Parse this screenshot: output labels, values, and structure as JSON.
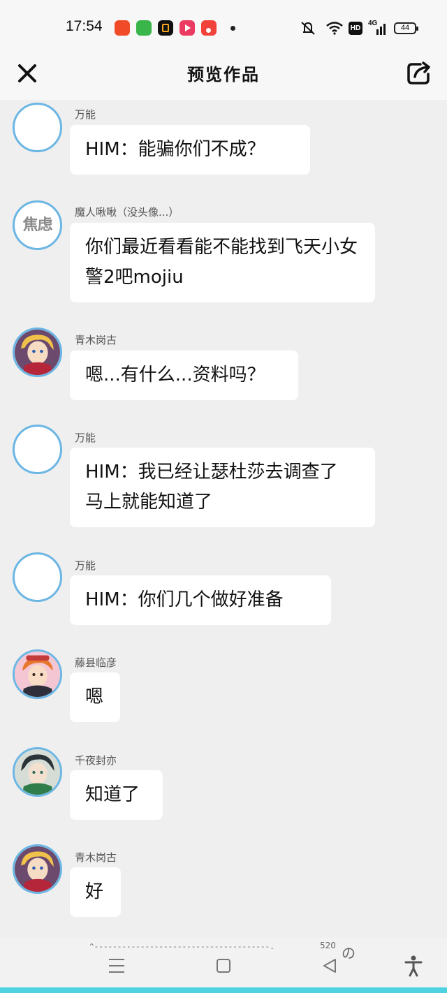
{
  "status_bar": {
    "time": "17:54",
    "battery": "44",
    "network": "4G",
    "hd": "HD",
    "app_icons": [
      {
        "name": "pinduoduo-icon",
        "color": "#f04a28"
      },
      {
        "name": "android-app-icon",
        "color": "#39b54a"
      },
      {
        "name": "black-app-icon",
        "color": "#111111"
      },
      {
        "name": "video-app-icon",
        "color": "#ec3b62"
      },
      {
        "name": "music-app-icon",
        "color": "#f1433b"
      }
    ]
  },
  "header": {
    "title": "预览作品",
    "close_icon": "close-icon",
    "share_icon": "share-icon"
  },
  "messages": [
    {
      "user": "万能",
      "text": "HIM：能骗你们不成？",
      "avatar": "blank"
    },
    {
      "user": "魔人啾啾（没头像...）",
      "text": "你们最近看看能不能找到飞天小女警2吧mojiu",
      "avatar": "text",
      "avatar_text": "焦虑"
    },
    {
      "user": "青木岗古",
      "text": "嗯...有什么...资料吗？",
      "avatar": "anime-yellow-hair"
    },
    {
      "user": "万能",
      "text": "HIM：我已经让瑟杜莎去调查了 马上就能知道了",
      "avatar": "blank"
    },
    {
      "user": "万能",
      "text": "HIM：你们几个做好准备",
      "avatar": "blank"
    },
    {
      "user": "藤县临彦",
      "text": "嗯",
      "avatar": "anime-orange-hair"
    },
    {
      "user": "千夜封亦",
      "text": "知道了",
      "avatar": "anime-dark-hair"
    },
    {
      "user": "青木岗古",
      "text": "好",
      "avatar": "anime-yellow-hair"
    }
  ],
  "keyboard_hint": {
    "dashes": "^--------------------------------------.",
    "number": "520",
    "char": "の"
  },
  "colors": {
    "accent_border": "#6cb6e4",
    "bottom_strip": "#4dd2e0"
  }
}
